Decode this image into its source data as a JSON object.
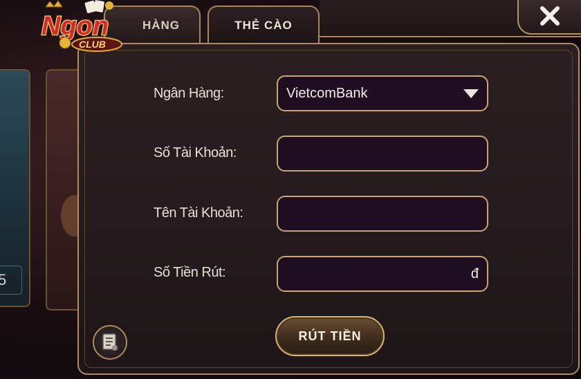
{
  "logo": {
    "text_main": "Ngon",
    "text_sub": "CLUB"
  },
  "side_card": {
    "number": "5"
  },
  "tabs": [
    {
      "label": "HÀNG"
    },
    {
      "label": "THẺ CÀO"
    }
  ],
  "form": {
    "bank_label": "Ngân Hàng:",
    "bank_value": "VietcomBank",
    "account_number_label": "Số Tài Khoản:",
    "account_number_value": "",
    "account_name_label": "Tên Tài Khoản:",
    "account_name_value": "",
    "amount_label": "Số Tiền Rút:",
    "amount_value": "",
    "currency_unit": "đ"
  },
  "submit_label": "RÚT TIỀN",
  "icons": {
    "close": "close-icon",
    "history": "history-icon",
    "dropdown": "chevron-down-icon"
  },
  "colors": {
    "accent_gold": "#c9a86e",
    "panel_bg": "#241a1d",
    "field_bg": "#1f0d22",
    "logo_red": "#d32b2b"
  }
}
